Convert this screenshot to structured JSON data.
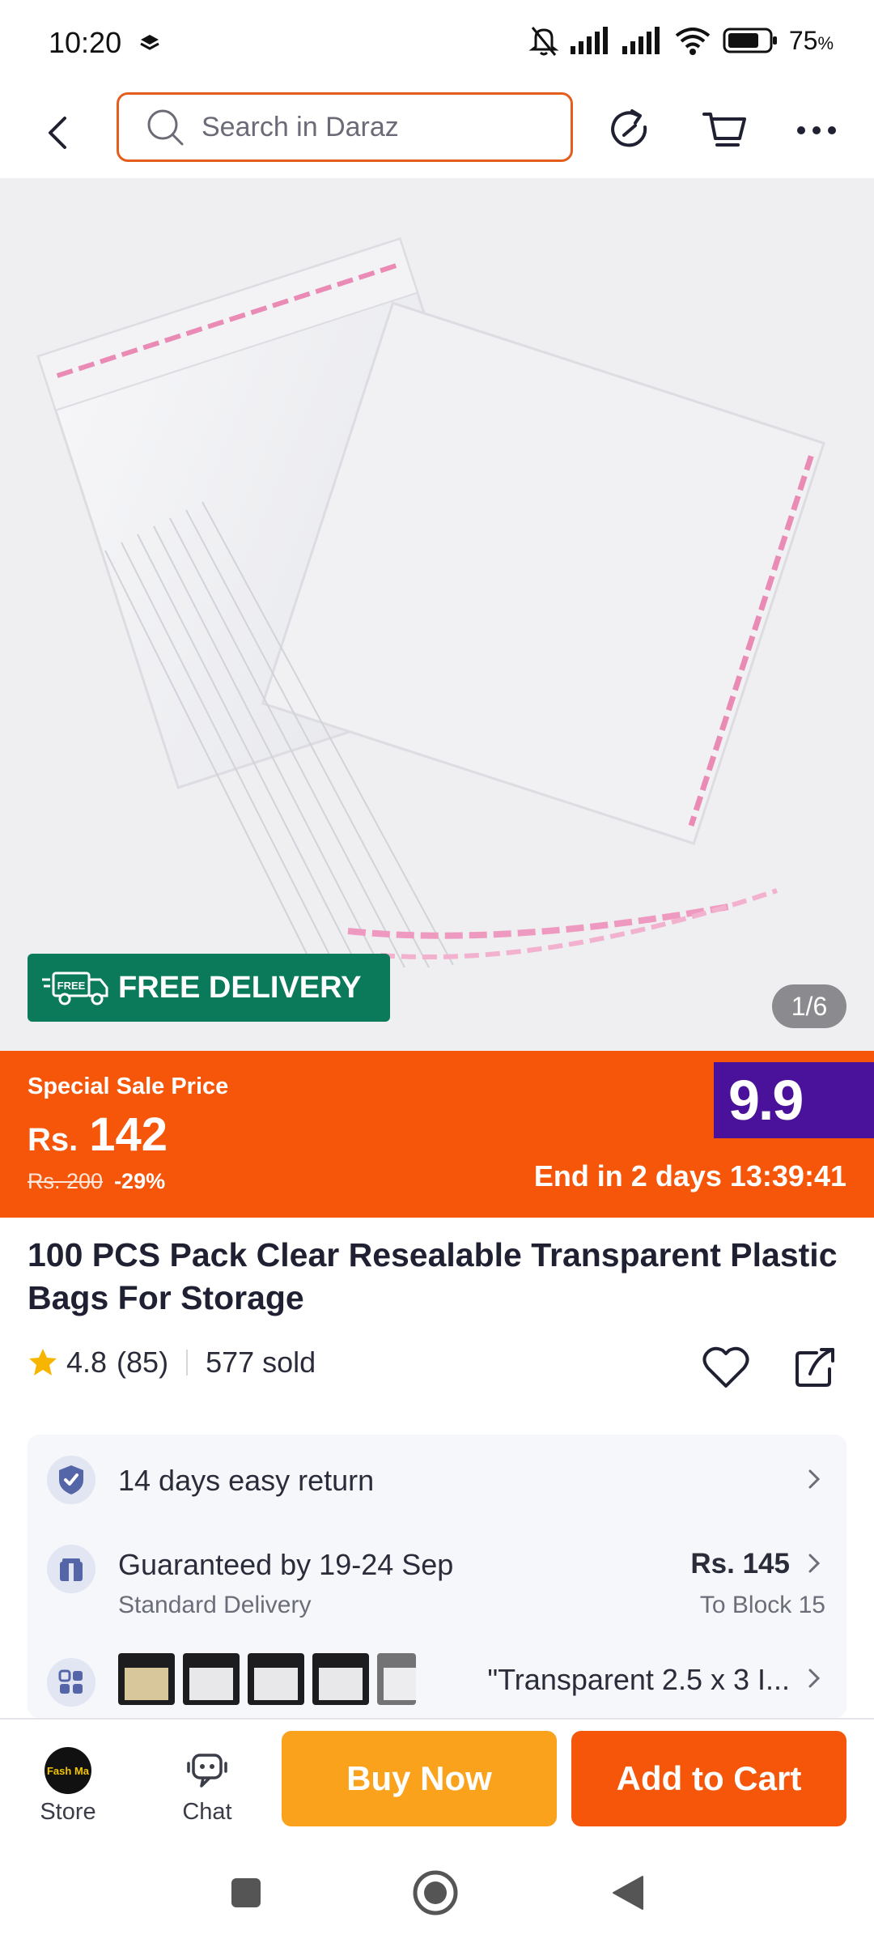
{
  "status_bar": {
    "time": "10:20",
    "battery": "75",
    "battery_unit": "%",
    "icons": [
      "layers-icon",
      "mute-bell-icon",
      "signal-icon",
      "signal-icon",
      "wifi-icon",
      "battery-icon"
    ]
  },
  "nav": {
    "back_icon": "back-arrow-icon",
    "search_placeholder": "Search in Daraz",
    "icons": [
      "refresh-share-icon",
      "cart-icon",
      "more-icon"
    ]
  },
  "product_image": {
    "free_delivery_tag": "FREE",
    "free_delivery": "FREE DELIVERY",
    "counter": "1/6"
  },
  "sale": {
    "label": "Special Sale Price",
    "currency": "Rs.",
    "price": "142",
    "old_price": "Rs. 200",
    "discount": "-29%",
    "campaign_badge": "9.9",
    "end_text": "End in 2 days 13:39:41",
    "colors": {
      "banner": "#f5560a",
      "badge": "#4a129a"
    }
  },
  "product": {
    "title": "100 PCS Pack Clear Resealable Transparent Plastic Bags For Storage",
    "rating": "4.8",
    "reviews": "(85)",
    "sold": "577 sold"
  },
  "info": {
    "return": "14 days easy return",
    "delivery_title": "Guaranteed by 19-24 Sep",
    "delivery_type": "Standard Delivery",
    "delivery_price": "Rs. 145",
    "delivery_location": "To Block 15",
    "variant": "\"Transparent 2.5 x 3 I..."
  },
  "bottom_bar": {
    "store_label": "Store",
    "store_avatar_text": "Fash Ma",
    "chat_label": "Chat",
    "buy_now": "Buy Now",
    "add_to_cart": "Add to Cart"
  }
}
